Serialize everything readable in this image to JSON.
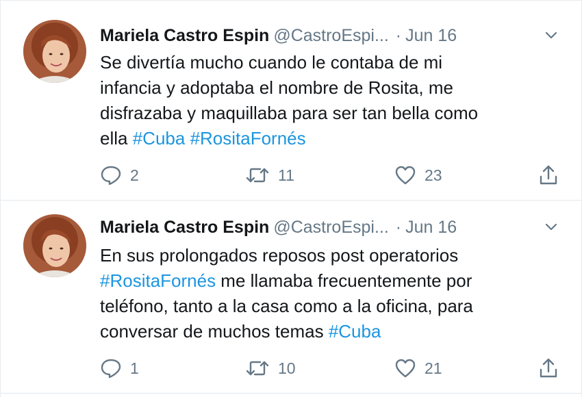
{
  "tweets": [
    {
      "author_name": "Mariela Castro Espin",
      "handle": "@CastroEspi...",
      "separator": "·",
      "date": "Jun 16",
      "text_lines": [
        [
          {
            "t": "Se divertía mucho cuando le contaba de mi",
            "tag": false
          }
        ],
        [
          {
            "t": "infancia y adoptaba el nombre de Rosita, me",
            "tag": false
          }
        ],
        [
          {
            "t": "disfrazaba y maquillaba para ser tan bella como",
            "tag": false
          }
        ],
        [
          {
            "t": "ella ",
            "tag": false
          },
          {
            "t": "#Cuba",
            "tag": true
          },
          {
            "t": " ",
            "tag": false
          },
          {
            "t": "#RositaFornés",
            "tag": true
          }
        ]
      ],
      "replies": "2",
      "retweets": "11",
      "likes": "23"
    },
    {
      "author_name": "Mariela Castro Espin",
      "handle": "@CastroEspi...",
      "separator": "·",
      "date": "Jun 16",
      "text_lines": [
        [
          {
            "t": "En sus prolongados reposos post operatorios",
            "tag": false
          }
        ],
        [
          {
            "t": "#RositaFornés",
            "tag": true
          },
          {
            "t": " me llamaba frecuentemente por",
            "tag": false
          }
        ],
        [
          {
            "t": "teléfono, tanto a la casa como a la oficina, para",
            "tag": false
          }
        ],
        [
          {
            "t": "conversar de muchos temas ",
            "tag": false
          },
          {
            "t": "#Cuba",
            "tag": true
          }
        ]
      ],
      "replies": "1",
      "retweets": "10",
      "likes": "21"
    }
  ],
  "icons": {
    "reply": "reply-icon",
    "retweet": "retweet-icon",
    "like": "heart-icon",
    "share": "share-icon",
    "more": "chevron-down-icon"
  },
  "colors": {
    "text": "#14171a",
    "secondary": "#657786",
    "hashtag": "#1b95e0",
    "divider": "#e1e8ed"
  }
}
